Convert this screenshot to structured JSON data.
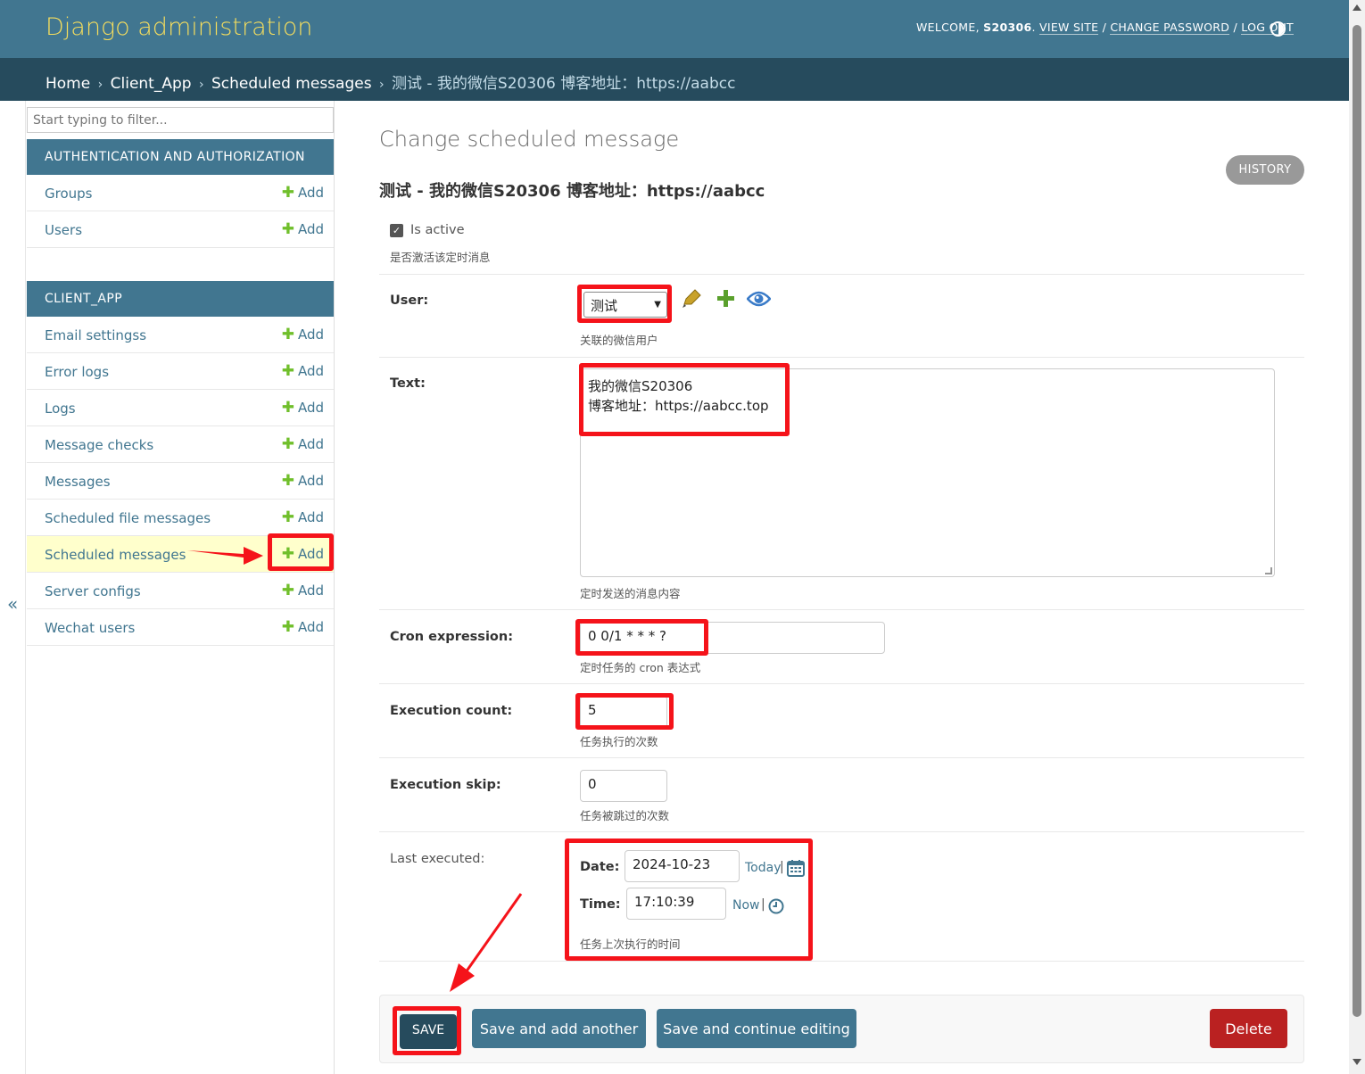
{
  "header": {
    "branding": "Django administration",
    "welcome": "WELCOME,",
    "username": "S20306",
    "view_site": "VIEW SITE",
    "change_password": "CHANGE PASSWORD",
    "log_out": "LOG OUT",
    "slash": "/"
  },
  "breadcrumbs": {
    "home": "Home",
    "app": "Client_App",
    "model": "Scheduled messages",
    "current": "测试 - 我的微信S20306 博客地址：https://aabcc",
    "separator": "›"
  },
  "sidebar": {
    "filter_placeholder": "Start typing to filter...",
    "collapse_glyph": "«",
    "add_label": "Add",
    "auth_caption": "AUTHENTICATION AND AUTHORIZATION",
    "auth_items": [
      "Groups",
      "Users"
    ],
    "client_caption": "CLIENT_APP",
    "client_items": [
      "Email settingss",
      "Error logs",
      "Logs",
      "Message checks",
      "Messages",
      "Scheduled file messages",
      "Scheduled messages",
      "Server configs",
      "Wechat users"
    ],
    "current_item": "Scheduled messages"
  },
  "content": {
    "title": "Change scheduled message",
    "history": "HISTORY",
    "object_title": "测试 - 我的微信S20306 博客地址：https://aabcc"
  },
  "form": {
    "is_active": {
      "label": "Is active",
      "help": "是否激活该定时消息",
      "checked": true
    },
    "user": {
      "label": "User:",
      "value": "测试",
      "help": "关联的微信用户"
    },
    "text": {
      "label": "Text:",
      "line1": "我的微信S20306",
      "line2": "博客地址：https://aabcc.top",
      "help": "定时发送的消息内容"
    },
    "cron": {
      "label": "Cron expression:",
      "value": "0 0/1 * * * ?",
      "help": "定时任务的 cron 表达式"
    },
    "exec_count": {
      "label": "Execution count:",
      "value": "5",
      "help": "任务执行的次数"
    },
    "exec_skip": {
      "label": "Execution skip:",
      "value": "0",
      "help": "任务被跳过的次数"
    },
    "last_executed": {
      "label": "Last executed:",
      "date_label": "Date:",
      "date_value": "2024-10-23",
      "today": "Today",
      "time_label": "Time:",
      "time_value": "17:10:39",
      "now": "Now",
      "pipe": "|",
      "help": "任务上次执行的时间"
    }
  },
  "buttons": {
    "save": "SAVE",
    "save_add": "Save and add another",
    "save_continue": "Save and continue editing",
    "delete": "Delete"
  },
  "colors": {
    "header_bg": "#417690",
    "breadcrumb_bg": "#264b5d",
    "branding": "#f5dd5d",
    "annotation_red": "#f5131a",
    "delete": "#ba2121",
    "add_plus": "#70bf2b"
  },
  "icons": [
    "pencil-icon",
    "plus-icon",
    "eye-icon",
    "calendar-icon",
    "clock-icon",
    "theme-toggle-icon",
    "arrow-annotation"
  ]
}
